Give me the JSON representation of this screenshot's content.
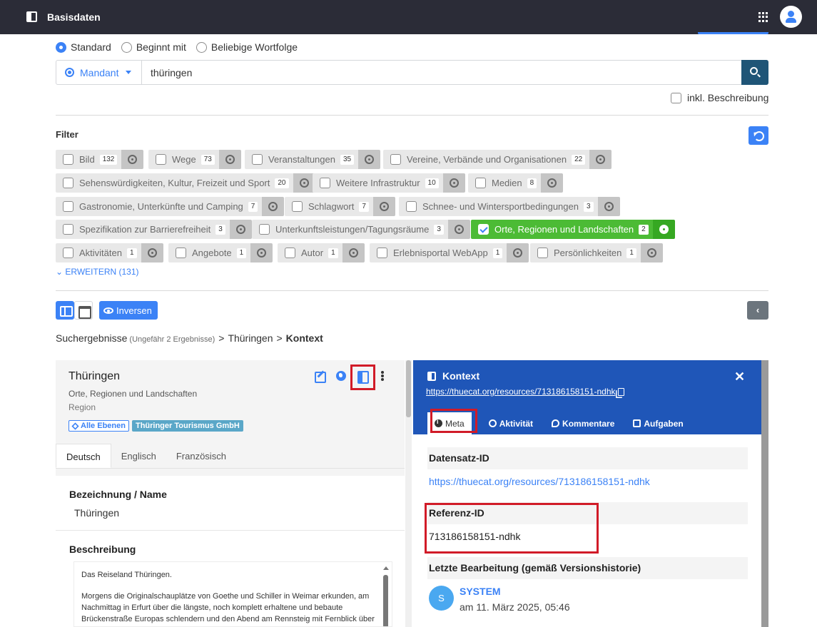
{
  "topbar": {
    "title": "Basisdaten"
  },
  "search_mode": {
    "options": [
      "Standard",
      "Beginnt mit",
      "Beliebige Wortfolge"
    ],
    "selected": "Standard"
  },
  "search": {
    "scope_label": "Mandant",
    "query": "thüringen",
    "include_description_label": "inkl. Beschreibung"
  },
  "filter": {
    "title": "Filter",
    "chips": [
      {
        "label": "Bild",
        "count": "132",
        "checked": false
      },
      {
        "label": "Wege",
        "count": "73",
        "checked": false
      },
      {
        "label": "Veranstaltungen",
        "count": "35",
        "checked": false
      },
      {
        "label": "Vereine, Verbände und Organisationen",
        "count": "22",
        "checked": false
      },
      {
        "label": "Sehenswürdigkeiten, Kultur, Freizeit und Sport",
        "count": "20",
        "checked": false
      },
      {
        "label": "Weitere Infrastruktur",
        "count": "10",
        "checked": false
      },
      {
        "label": "Medien",
        "count": "8",
        "checked": false
      },
      {
        "label": "Gastronomie, Unterkünfte und Camping",
        "count": "7",
        "checked": false
      },
      {
        "label": "Schlagwort",
        "count": "7",
        "checked": false
      },
      {
        "label": "Schnee- und Wintersportbedingungen",
        "count": "3",
        "checked": false
      },
      {
        "label": "Spezifikation zur Barrierefreiheit",
        "count": "3",
        "checked": false
      },
      {
        "label": "Unterkunftsleistungen/Tagungsräume",
        "count": "3",
        "checked": false
      },
      {
        "label": "Orte, Regionen und Landschaften",
        "count": "2",
        "checked": true
      },
      {
        "label": "Aktivitäten",
        "count": "1",
        "checked": false
      },
      {
        "label": "Angebote",
        "count": "1",
        "checked": false
      },
      {
        "label": "Autor",
        "count": "1",
        "checked": false
      },
      {
        "label": "Erlebnisportal WebApp",
        "count": "1",
        "checked": false
      },
      {
        "label": "Persönlichkeiten",
        "count": "1",
        "checked": false
      }
    ],
    "expand_label": "ERWEITERN (131)"
  },
  "toolbar": {
    "inverse_label": "Inversen"
  },
  "breadcrumb": {
    "root": "Suchergebnisse",
    "hint": "(Ungefähr 2 Ergebnisse)",
    "sep": ">",
    "level1": "Thüringen",
    "level2": "Kontext"
  },
  "detail": {
    "title": "Thüringen",
    "type": "Orte, Regionen und Landschaften",
    "subtype": "Region",
    "badge_levels": "Alle Ebenen",
    "badge_org": "Thüringer Tourismus GmbH",
    "lang_tabs": [
      "Deutsch",
      "Englisch",
      "Französisch"
    ],
    "name_label": "Bezeichnung / Name",
    "name_value": "Thüringen",
    "desc_label": "Beschreibung",
    "desc_para1": "Das Reiseland Thüringen.",
    "desc_para2": "Morgens die Originalschauplätze von Goethe und Schiller in Weimar erkunden, am Nachmittag in Erfurt über die längste, noch komplett erhaltene und bebaute Brückenstraße Europas schlendern und den Abend am Rennsteig mit Fernblick über die tiefen Wälder des Thüringer Waldes ausklingen lassen. Das ist tatsächlich möglich"
  },
  "context": {
    "title": "Kontext",
    "url": "https://thuecat.org/resources/713186158151-ndhk",
    "tabs": [
      "Meta",
      "Aktivität",
      "Kommentare",
      "Aufgaben"
    ],
    "dataset_id_label": "Datensatz-ID",
    "dataset_id_value": "https://thuecat.org/resources/713186158151-ndhk",
    "ref_id_label": "Referenz-ID",
    "ref_id_value": "713186158151-ndhk",
    "last_edit_label": "Letzte Bearbeitung (gemäß Versionshistorie)",
    "editor_initial": "S",
    "editor_name": "SYSTEM",
    "edit_date": "am 11. März 2025, 05:46"
  }
}
